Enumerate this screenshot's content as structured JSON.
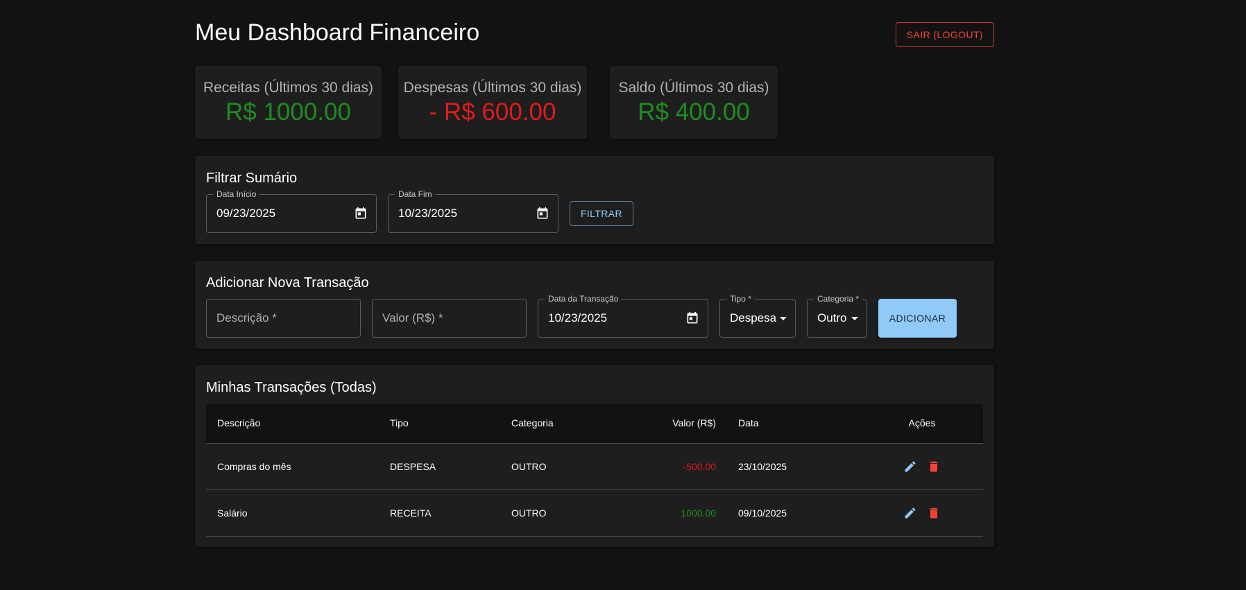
{
  "header": {
    "title": "Meu Dashboard Financeiro",
    "logout_label": "SAIR (LOGOUT)"
  },
  "summary": {
    "income": {
      "label": "Receitas (Últimos 30 dias)",
      "value": "R$ 1000.00"
    },
    "expenses": {
      "label": "Despesas (Últimos 30 dias)",
      "value": "- R$ 600.00"
    },
    "balance": {
      "label": "Saldo (Últimos 30 dias)",
      "value": "R$ 400.00"
    }
  },
  "filter": {
    "title": "Filtrar Sumário",
    "start": {
      "label": "Data Início",
      "value": "09/23/2025"
    },
    "end": {
      "label": "Data Fim",
      "value": "10/23/2025"
    },
    "button_label": "FILTRAR"
  },
  "add_transaction": {
    "title": "Adicionar Nova Transação",
    "description_placeholder": "Descrição *",
    "amount_placeholder": "Valor (R$) *",
    "date": {
      "label": "Data da Transação",
      "value": "10/23/2025"
    },
    "type": {
      "label": "Tipo *",
      "value": "Despesa"
    },
    "category": {
      "label": "Categoria *",
      "value": "Outro"
    },
    "button_label": "ADICIONAR"
  },
  "transactions": {
    "title": "Minhas Transações (Todas)",
    "columns": [
      "Descrição",
      "Tipo",
      "Categoria",
      "Valor (R$)",
      "Data",
      "Ações"
    ],
    "rows": [
      {
        "description": "Compras do mês",
        "type": "DESPESA",
        "category": "OUTRO",
        "amount": "-500.00",
        "date": "23/10/2025"
      },
      {
        "description": "Salário",
        "type": "RECEITA",
        "category": "OUTRO",
        "amount": "1000.00",
        "date": "09/10/2025"
      }
    ]
  },
  "colors": {
    "background": "#121212",
    "card": "#1e1e1e",
    "positive": "#1e8e1e",
    "negative": "#e01b1b",
    "primary": "#90caf9",
    "logout": "#f44336"
  },
  "icons": {
    "calendar": "calendar-icon",
    "dropdown": "arrow-drop-down-icon",
    "edit": "pencil-icon",
    "delete": "trash-icon"
  }
}
